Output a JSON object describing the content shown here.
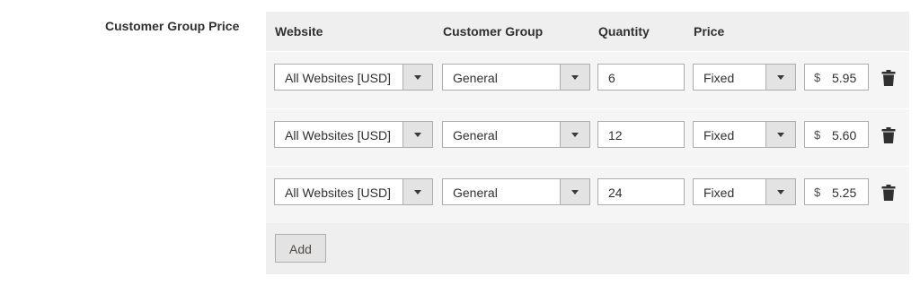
{
  "field": {
    "label": "Customer Group Price"
  },
  "headers": {
    "website": "Website",
    "customer_group": "Customer Group",
    "quantity": "Quantity",
    "price": "Price"
  },
  "rows": [
    {
      "website": "All Websites [USD]",
      "customer_group": "General",
      "quantity": "6",
      "price_type": "Fixed",
      "currency": "$",
      "price": "5.95"
    },
    {
      "website": "All Websites [USD]",
      "customer_group": "General",
      "quantity": "12",
      "price_type": "Fixed",
      "currency": "$",
      "price": "5.60"
    },
    {
      "website": "All Websites [USD]",
      "customer_group": "General",
      "quantity": "24",
      "price_type": "Fixed",
      "currency": "$",
      "price": "5.25"
    }
  ],
  "actions": {
    "add_label": "Add"
  },
  "icons": {
    "dropdown": "chevron-down-icon",
    "delete": "trash-icon"
  },
  "colors": {
    "grid_background": "#efefef",
    "row_background": "#f5f5f5",
    "border": "#adadad",
    "button_background": "#e3e3e3",
    "icon": "#303030"
  }
}
